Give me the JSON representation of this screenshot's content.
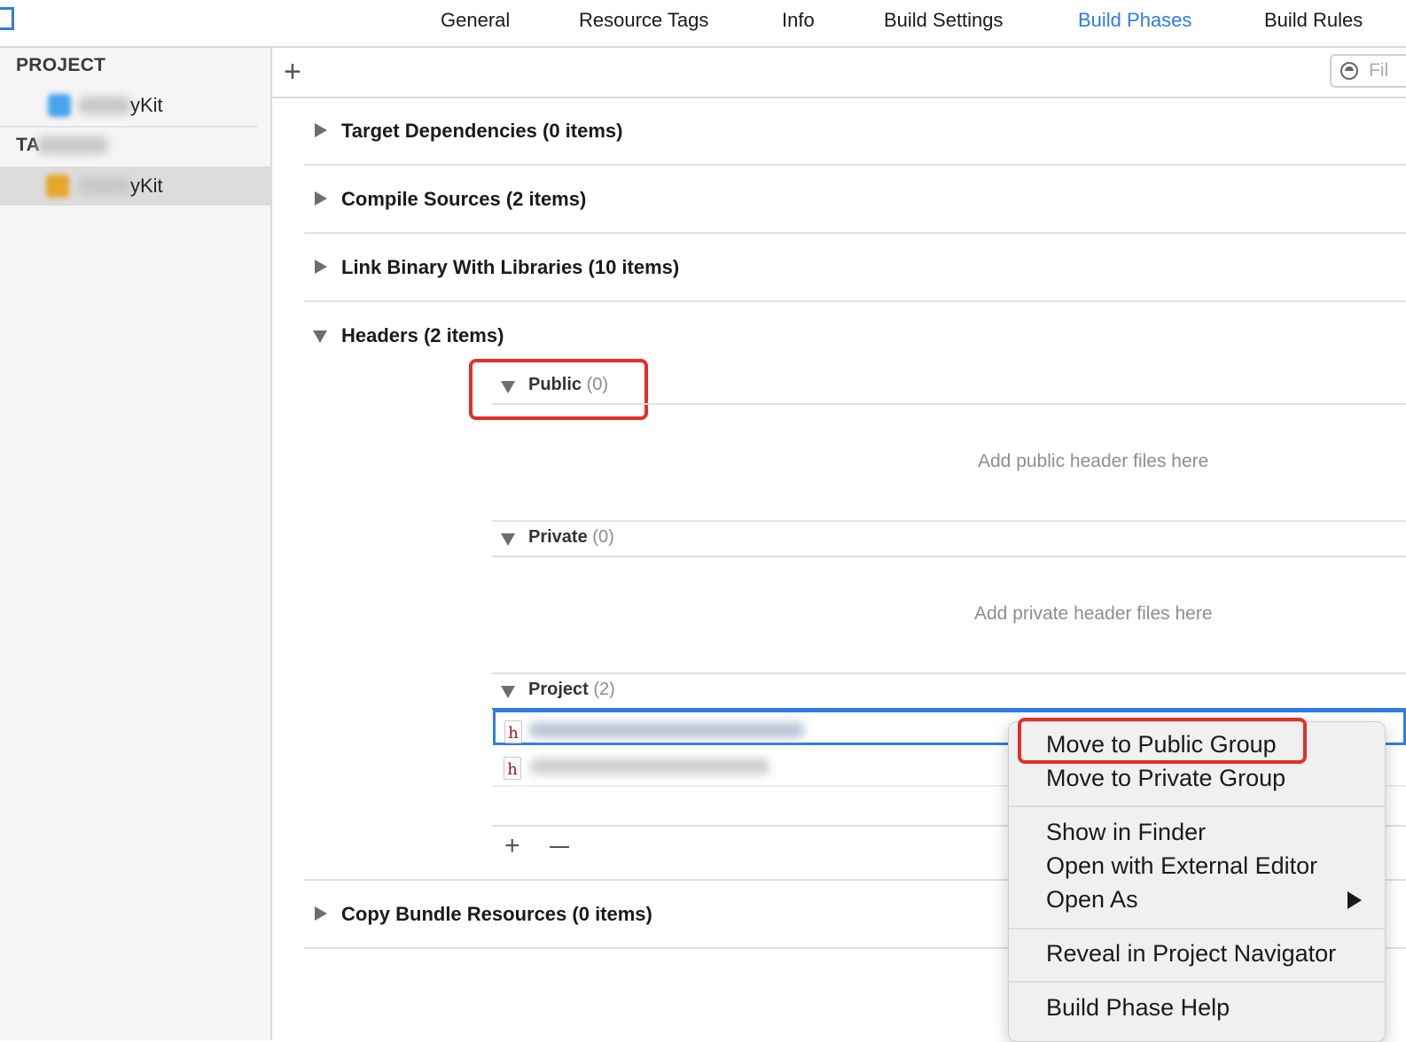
{
  "tabs": [
    {
      "label": "General"
    },
    {
      "label": "Resource Tags"
    },
    {
      "label": "Info"
    },
    {
      "label": "Build Settings"
    },
    {
      "label": "Build Phases",
      "active": true
    },
    {
      "label": "Build Rules"
    }
  ],
  "sidebar": {
    "project_header": "PROJECT",
    "project_item": "yKit",
    "targets_header": "TA",
    "target_item": "yKit"
  },
  "toolbar": {
    "add_icon": "plus-icon",
    "filter_placeholder": "Fil"
  },
  "phases": {
    "target_dependencies": "Target Dependencies (0 items)",
    "compile_sources": "Compile Sources (2 items)",
    "link_binary": "Link Binary With Libraries (10 items)",
    "headers": "Headers (2 items)",
    "copy_bundle": "Copy Bundle Resources (0 items)"
  },
  "headers": {
    "public": {
      "label": "Public",
      "count": "(0)",
      "placeholder": "Add public header files here"
    },
    "private": {
      "label": "Private",
      "count": "(0)",
      "placeholder": "Add private header files here"
    },
    "project": {
      "label": "Project",
      "count": "(2)"
    },
    "file_icon_letter": "h"
  },
  "context_menu": {
    "items": [
      "Move to Public Group",
      "Move to Private Group",
      "Show in Finder",
      "Open with External Editor",
      "Open As",
      "Reveal in Project Navigator",
      "Build Phase Help"
    ]
  },
  "colors": {
    "accent": "#2f7ce5",
    "highlight": "#e0302a",
    "sidebar_bg": "#f5f5f5",
    "menu_bg": "#f0f0f0"
  }
}
